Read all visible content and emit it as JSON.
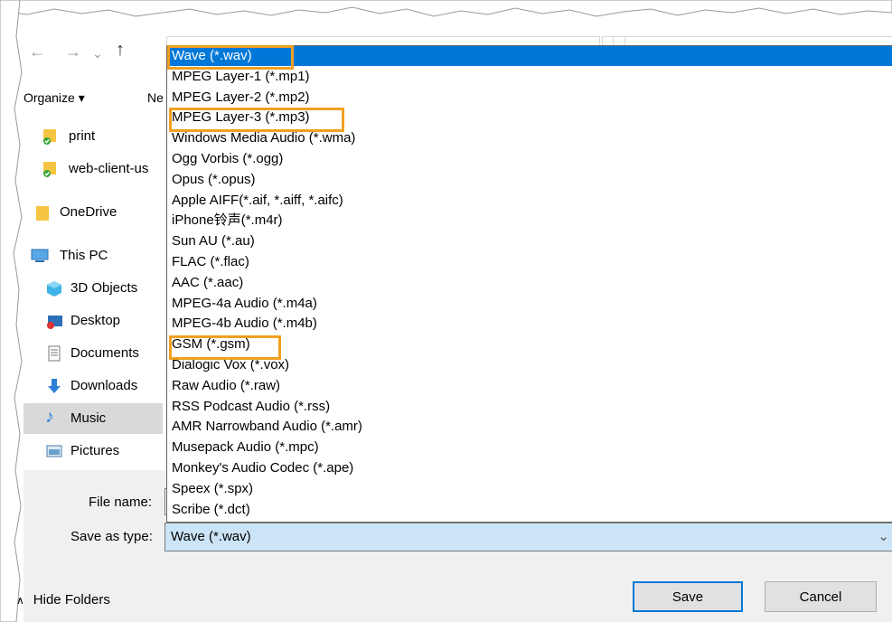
{
  "nav": {
    "organize_label": "Organize ▾",
    "new_folder_label": "Ne",
    "items": [
      {
        "label": "print",
        "icon": "synced-folder-icon"
      },
      {
        "label": "web-client-us",
        "icon": "synced-folder-icon"
      },
      {
        "label": "OneDrive",
        "icon": "folder-icon"
      },
      {
        "label": "This PC",
        "icon": "computer-icon"
      },
      {
        "label": "3D Objects",
        "icon": "cube-icon"
      },
      {
        "label": "Desktop",
        "icon": "desktop-icon"
      },
      {
        "label": "Documents",
        "icon": "document-icon"
      },
      {
        "label": "Downloads",
        "icon": "download-icon"
      },
      {
        "label": "Music",
        "icon": "music-icon"
      },
      {
        "label": "Pictures",
        "icon": "pictures-icon"
      }
    ]
  },
  "file_types": [
    "Wave (*.wav)",
    "MPEG Layer-1 (*.mp1)",
    "MPEG Layer-2 (*.mp2)",
    "MPEG Layer-3 (*.mp3)",
    "Windows Media Audio (*.wma)",
    "Ogg Vorbis (*.ogg)",
    "Opus (*.opus)",
    "Apple AIFF(*.aif, *.aiff, *.aifc)",
    "iPhone铃声(*.m4r)",
    "Sun AU (*.au)",
    "FLAC (*.flac)",
    "AAC (*.aac)",
    "MPEG-4a Audio (*.m4a)",
    "MPEG-4b Audio (*.m4b)",
    "GSM (*.gsm)",
    "Dialogic Vox (*.vox)",
    "Raw Audio (*.raw)",
    "RSS Podcast Audio (*.rss)",
    "AMR Narrowband Audio (*.amr)",
    "Musepack Audio (*.mpc)",
    "Monkey's Audio Codec (*.ape)",
    "Speex (*.spx)",
    "Scribe (*.dct)"
  ],
  "selected_type": "Wave (*.wav)",
  "footer": {
    "file_name_label": "File name:",
    "save_as_type_label": "Save as type:",
    "save_as_type_value": "Wave (*.wav)",
    "hide_folders_label": "Hide Folders",
    "save_button": "Save",
    "cancel_button": "Cancel"
  },
  "colors": {
    "selection": "#0078d7",
    "highlight_box": "#f0a020",
    "nav_selected": "#cce4f7"
  }
}
